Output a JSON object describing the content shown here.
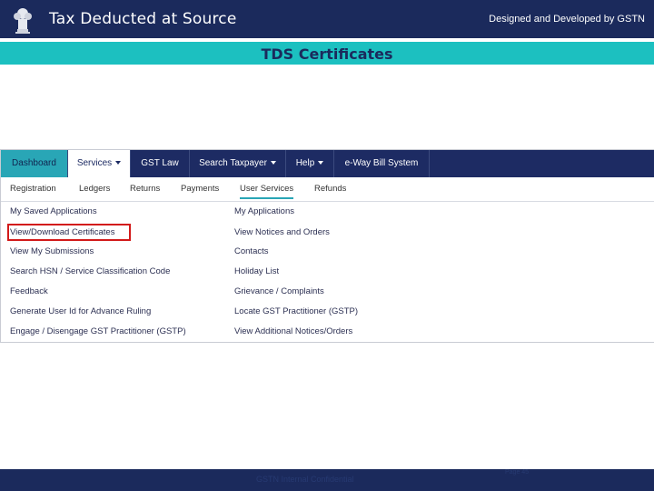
{
  "header": {
    "title": "Tax Deducted at Source",
    "credit": "Designed and Developed by GSTN",
    "emblem_icon": "national-emblem-icon"
  },
  "section": {
    "title": "TDS Certificates"
  },
  "portal": {
    "main_nav": [
      {
        "label": "Dashboard",
        "state": "active"
      },
      {
        "label": "Services",
        "state": "open",
        "dropdown": true
      },
      {
        "label": "GST Law"
      },
      {
        "label": "Search Taxpayer",
        "dropdown": true
      },
      {
        "label": "Help",
        "dropdown": true
      },
      {
        "label": "e-Way Bill System"
      }
    ],
    "sub_nav": [
      {
        "label": "Registration"
      },
      {
        "label": "Ledgers"
      },
      {
        "label": "Returns"
      },
      {
        "label": "Payments"
      },
      {
        "label": "User Services",
        "selected": true
      },
      {
        "label": "Refunds"
      }
    ],
    "menu_left": [
      "My Saved Applications",
      "View/Download Certificates",
      "View My Submissions",
      "Search HSN / Service Classification Code",
      "Feedback",
      "Generate User Id for Advance Ruling",
      "Engage / Disengage GST Practitioner (GSTP)"
    ],
    "menu_right": [
      "My Applications",
      "View Notices and Orders",
      "Contacts",
      "Holiday List",
      "Grievance / Complaints",
      "Locate GST Practitioner (GSTP)",
      "View Additional Notices/Orders"
    ],
    "highlighted_item": "View/Download Certificates",
    "highlight_color": "#d21a1a"
  },
  "footer": {
    "text": "GSTN Internal Confidential",
    "page": "Page 45"
  },
  "colors": {
    "header_bg": "#1b2a5c",
    "section_bg": "#1cc0c0",
    "nav_bg": "#1d2b63",
    "nav_active": "#29a6b6"
  }
}
